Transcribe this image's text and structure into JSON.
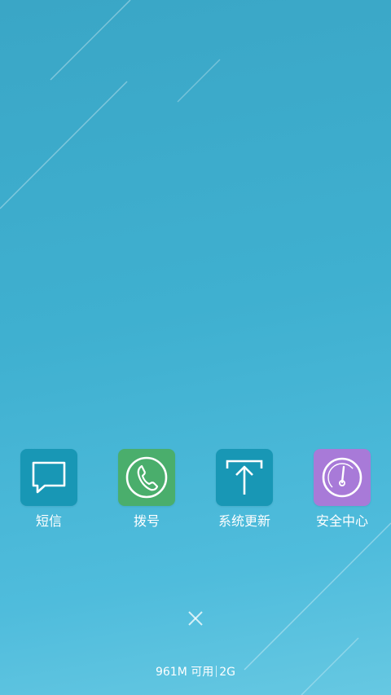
{
  "apps": [
    {
      "label": "短信",
      "icon": "message-icon",
      "color": "#1897b5"
    },
    {
      "label": "拨号",
      "icon": "phone-icon",
      "color": "#4aae6c"
    },
    {
      "label": "系统更新",
      "icon": "upload-icon",
      "color": "#1897b5"
    },
    {
      "label": "安全中心",
      "icon": "speedometer-icon",
      "color": "#a87ad8"
    }
  ],
  "close": {
    "icon": "close-icon"
  },
  "status": {
    "memory": "961M 可用",
    "network": "2G"
  },
  "colors": {
    "background": "#3fb0d0",
    "text": "#ffffff"
  }
}
